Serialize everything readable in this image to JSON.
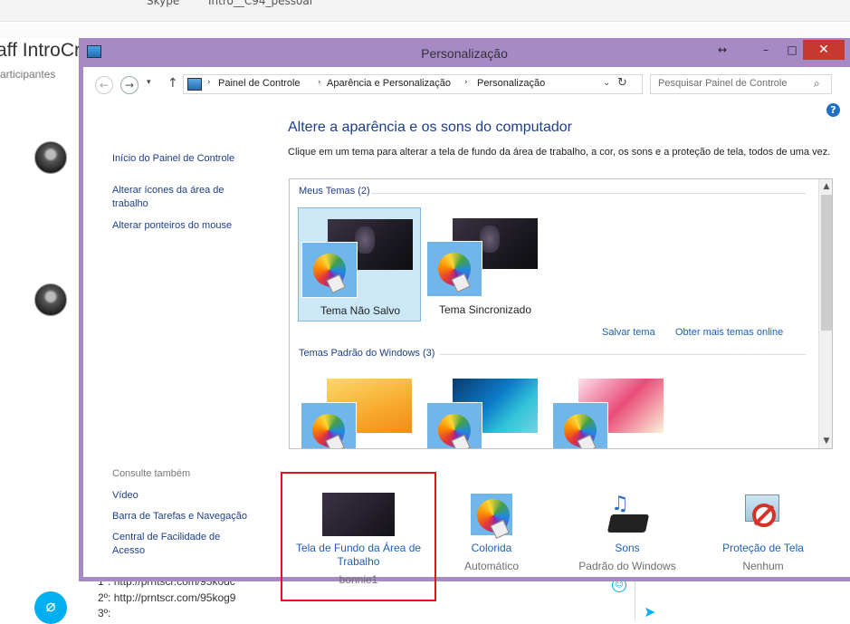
{
  "background": {
    "top_title": "Skype",
    "top_title2": "Intro__C94_pessoal",
    "chat_title": "aff IntroCr",
    "chat_subtitle": "articipantes",
    "messages": [
      "1º: http://prntscr.com/95k0dc",
      "2º: http://prntscr.com/95kog9",
      "3º:"
    ]
  },
  "window": {
    "title": "Personalização",
    "restore_icon": "↔",
    "minimize_icon": "–",
    "maximize_icon": "□",
    "close_icon": "✕"
  },
  "address": {
    "back_icon": "←",
    "forward_icon": "→",
    "dropdown_icon": "▾",
    "up_icon": "↑",
    "crumbs": [
      "Painel de Controle",
      "Aparência e Personalização",
      "Personalização"
    ],
    "separator": "›",
    "crumb_dropdown_icon": "⌄",
    "refresh_icon": "↻",
    "search_placeholder": "Pesquisar Painel de Controle",
    "search_icon": "⌕"
  },
  "help_icon": "?",
  "sidebar": {
    "links": [
      "Início do Painel de Controle",
      "Alterar ícones da área de trabalho",
      "Alterar ponteiros do mouse"
    ],
    "see_also_heading": "Consulte também",
    "see_also": [
      "Vídeo",
      "Barra de Tarefas e Navegação",
      "Central de Facilidade de Acesso"
    ]
  },
  "main": {
    "title": "Altere a aparência e os sons do computador",
    "description": "Clique em um tema para alterar a tela de fundo da área de trabalho, a cor, os sons e a proteção de tela, todos de uma vez.",
    "my_themes_label": "Meus Temas (2)",
    "my_themes": [
      {
        "label": "Tema Não Salvo",
        "selected": true
      },
      {
        "label": "Tema Sincronizado",
        "selected": false
      }
    ],
    "save_theme": "Salvar tema",
    "more_themes": "Obter mais temas online",
    "default_themes_label": "Temas Padrão do Windows (3)",
    "scroll_up": "▲",
    "scroll_down": "▼"
  },
  "bottom": [
    {
      "label": "Tela de Fundo da Área de Trabalho",
      "sub": "bonnie1",
      "icon": "wallpaper-icon"
    },
    {
      "label": "Colorida",
      "sub": "Automático",
      "icon": "color-icon"
    },
    {
      "label": "Sons",
      "sub": "Padrão do Windows",
      "icon": "sound-icon"
    },
    {
      "label": "Proteção de Tela",
      "sub": "Nenhum",
      "icon": "screensaver-icon"
    }
  ],
  "colors": {
    "window_frame": "#a58ac6",
    "link": "#1e5fb3",
    "highlight_box": "#e2131b",
    "close_button": "#c7392f"
  }
}
